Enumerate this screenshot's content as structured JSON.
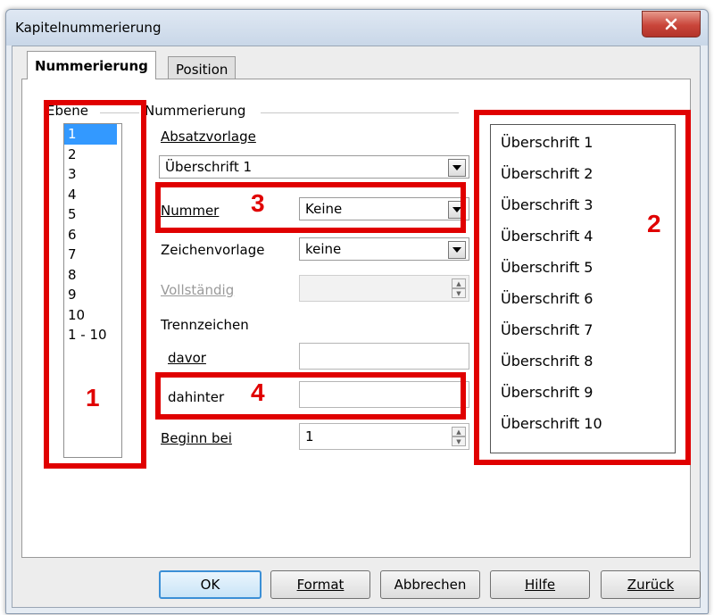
{
  "window": {
    "title": "Kapitelnummerierung"
  },
  "tabs": [
    {
      "label": "Nummerierung",
      "active": true
    },
    {
      "label": "Position",
      "active": false
    }
  ],
  "level_group": {
    "label": "Ebene",
    "items": [
      "1",
      "2",
      "3",
      "4",
      "5",
      "6",
      "7",
      "8",
      "9",
      "10",
      "1 - 10"
    ],
    "selected": "1"
  },
  "numbering_group": {
    "label": "Nummerierung",
    "absatzvorlage_label": "Absatzvorlage",
    "absatzvorlage_value": "Überschrift 1",
    "nummer_label": "Nummer",
    "nummer_value": "Keine",
    "zeichenvorlage_label": "Zeichenvorlage",
    "zeichenvorlage_value": "keine",
    "vollstaendig_label": "Vollständig",
    "vollstaendig_value": "",
    "trennzeichen_label": "Trennzeichen",
    "davor_label": "davor",
    "davor_value": "",
    "dahinter_label": "dahinter",
    "dahinter_value": "",
    "beginn_label": "Beginn bei",
    "beginn_value": "1"
  },
  "preview": {
    "items": [
      "Überschrift 1",
      "Überschrift 2",
      "Überschrift 3",
      "Überschrift 4",
      "Überschrift 5",
      "Überschrift 6",
      "Überschrift 7",
      "Überschrift 8",
      "Überschrift 9",
      "Überschrift 10"
    ]
  },
  "annotations": [
    "1",
    "2",
    "3",
    "4"
  ],
  "annotation_color": "#e00000",
  "buttons": {
    "ok": "OK",
    "format": "Format",
    "abbrechen": "Abbrechen",
    "hilfe": "Hilfe",
    "zurueck": "Zurück"
  }
}
